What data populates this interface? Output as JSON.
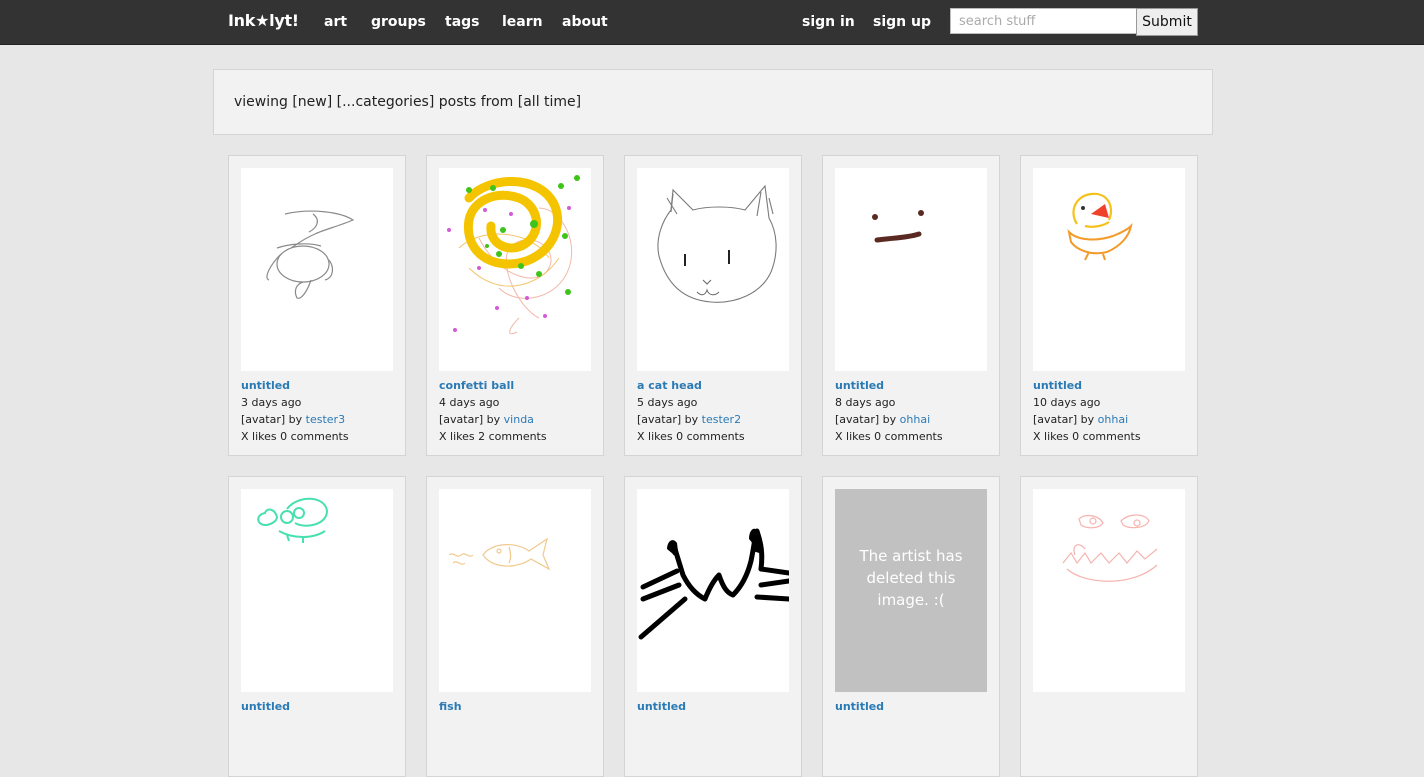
{
  "header": {
    "logo": "Ink★lyt!",
    "nav": [
      "art",
      "groups",
      "tags",
      "learn",
      "about"
    ],
    "auth": [
      "sign in",
      "sign up"
    ],
    "search_placeholder": "search stuff",
    "submit_label": "Submit"
  },
  "filter_text": "viewing [new] [...categories] posts from [all time]",
  "posts": [
    {
      "title": "untitled",
      "time": "3 days ago",
      "avatar": "[avatar]",
      "by": "by",
      "author": "tester3",
      "stats": "X likes 0 comments",
      "drawing": "scribble-pencil"
    },
    {
      "title": "confetti ball",
      "time": "4 days ago",
      "avatar": "[avatar]",
      "by": "by",
      "author": "vinda",
      "stats": "X likes 2 comments",
      "drawing": "confetti-ball"
    },
    {
      "title": "a cat head",
      "time": "5 days ago",
      "avatar": "[avatar]",
      "by": "by",
      "author": "tester2",
      "stats": "X likes 0 comments",
      "drawing": "cat-head"
    },
    {
      "title": "untitled",
      "time": "8 days ago",
      "avatar": "[avatar]",
      "by": "by",
      "author": "ohhai",
      "stats": "X likes 0 comments",
      "drawing": "face"
    },
    {
      "title": "untitled",
      "time": "10 days ago",
      "avatar": "[avatar]",
      "by": "by",
      "author": "ohhai",
      "stats": "X likes 0 comments",
      "drawing": "duck"
    },
    {
      "title": "untitled",
      "drawing": "green-face"
    },
    {
      "title": "fish",
      "drawing": "fish"
    },
    {
      "title": "untitled",
      "drawing": "black-cat"
    },
    {
      "title": "untitled",
      "drawing": "deleted",
      "deleted_message": "The artist has deleted this image. :("
    },
    {
      "title": "",
      "drawing": "pink-face"
    }
  ]
}
